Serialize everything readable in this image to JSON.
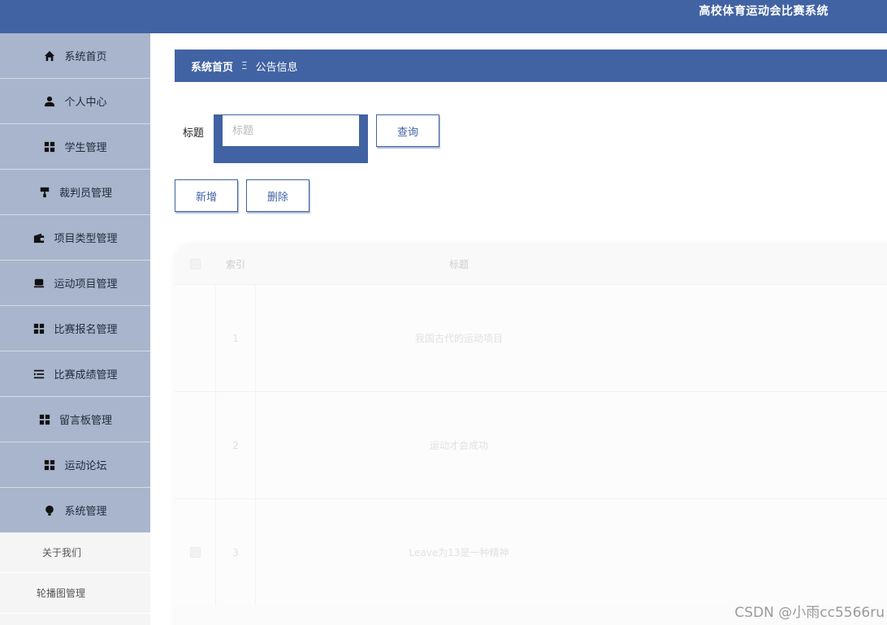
{
  "app": {
    "title": "高校体育运动会比赛系统"
  },
  "sidebar": {
    "items": [
      {
        "label": "系统首页",
        "icon": "home-icon"
      },
      {
        "label": "个人中心",
        "icon": "user-icon"
      },
      {
        "label": "学生管理",
        "icon": "grid-icon"
      },
      {
        "label": "裁判员管理",
        "icon": "paint-roller-icon"
      },
      {
        "label": "项目类型管理",
        "icon": "wallet-icon"
      },
      {
        "label": "运动项目管理",
        "icon": "tray-icon"
      },
      {
        "label": "比赛报名管理",
        "icon": "grid-icon"
      },
      {
        "label": "比赛成绩管理",
        "icon": "list-indent-icon"
      },
      {
        "label": "留言板管理",
        "icon": "grid-icon"
      },
      {
        "label": "运动论坛",
        "icon": "grid-icon"
      },
      {
        "label": "系统管理",
        "icon": "bulb-icon"
      }
    ],
    "sub_items": [
      {
        "label": "关于我们"
      },
      {
        "label": "轮播图管理"
      }
    ]
  },
  "breadcrumb": {
    "home": "系统首页",
    "separator": "Ξ",
    "current": "公告信息"
  },
  "search": {
    "label": "标题",
    "placeholder": "标题",
    "value": "",
    "query_label": "查询"
  },
  "actions": {
    "add_label": "新增",
    "delete_label": "删除"
  },
  "table": {
    "headers": {
      "index": "索引",
      "title": "标题"
    },
    "rows": [
      {
        "index": "1",
        "title": "我国古代的运动项目"
      },
      {
        "index": "2",
        "title": "运动才会成功"
      },
      {
        "index": "3",
        "title": "Leave为13是一种精神"
      }
    ]
  },
  "watermark": "CSDN @小雨cc5566ru",
  "colors": {
    "primary": "#4163a3",
    "sidebar": "#a9b5cc",
    "background": "#ffffff"
  }
}
